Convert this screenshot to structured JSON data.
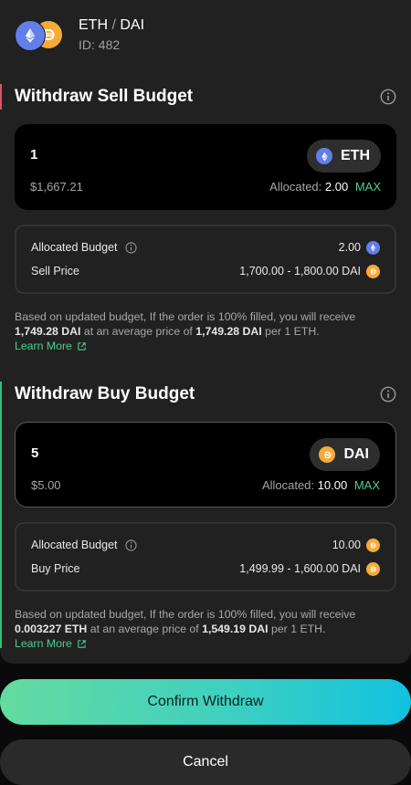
{
  "header": {
    "base": "ETH",
    "separator": "/",
    "quote": "DAI",
    "order_id": "ID: 482",
    "icons": [
      "eth-icon",
      "dai-icon"
    ]
  },
  "sell": {
    "title": "Withdraw Sell Budget",
    "amount": "1",
    "token": "ETH",
    "usd_value": "$1,667.21",
    "allocated_label": "Allocated:",
    "allocated_value": "2.00",
    "max_label": "MAX",
    "budget_label": "Allocated Budget",
    "budget_value": "2.00",
    "price_label": "Sell Price",
    "price_value": "1,700.00 - 1,800.00 DAI",
    "note_pre": "Based on updated budget, If the order is 100% filled, you will receive",
    "note_amount": "1,749.28 DAI",
    "note_mid": "at an average price of",
    "note_price": "1,749.28 DAI",
    "note_post": "per 1 ETH.",
    "learn_more": "Learn More"
  },
  "buy": {
    "title": "Withdraw Buy Budget",
    "amount": "5",
    "token": "DAI",
    "usd_value": "$5.00",
    "allocated_label": "Allocated:",
    "allocated_value": "10.00",
    "max_label": "MAX",
    "budget_label": "Allocated Budget",
    "budget_value": "10.00",
    "price_label": "Buy Price",
    "price_value": "1,499.99 - 1,600.00 DAI",
    "note_pre": "Based on updated budget, If the order is 100% filled, you will receive",
    "note_amount": "0.003227 ETH",
    "note_mid": "at an average price of",
    "note_price": "1,549.19 DAI",
    "note_post": "per 1 ETH.",
    "learn_more": "Learn More"
  },
  "actions": {
    "confirm": "Confirm Withdraw",
    "cancel": "Cancel"
  },
  "colors": {
    "sell_accent": "#d9546a",
    "buy_accent": "#2fbf7a",
    "max_green": "#4ece93",
    "eth": "#627eea",
    "dai": "#f5ac37"
  }
}
